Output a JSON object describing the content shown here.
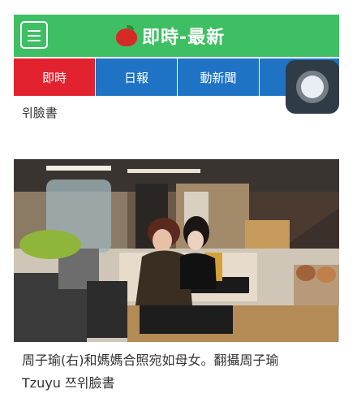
{
  "header": {
    "menu_icon": "hamburger-menu-icon",
    "logo_icon": "apple-icon",
    "title": "即時-最新"
  },
  "tabs": [
    {
      "label": "即時",
      "active": true
    },
    {
      "label": "日報",
      "active": false
    },
    {
      "label": "動新聞",
      "active": false
    },
    {
      "label": "",
      "active": false
    }
  ],
  "colors": {
    "header_green": "#3fbf63",
    "active_tab_red": "#e3222f",
    "tab_blue": "#1e73c5"
  },
  "source_top": "위臉書",
  "article": {
    "caption_line1": "周子瑜(右)和媽媽合照宛如母女。翻攝周子瑜",
    "caption_line2": "Tzuyu 쯔위臉書"
  },
  "floating_button": {
    "icon": "assistive-touch-icon"
  }
}
